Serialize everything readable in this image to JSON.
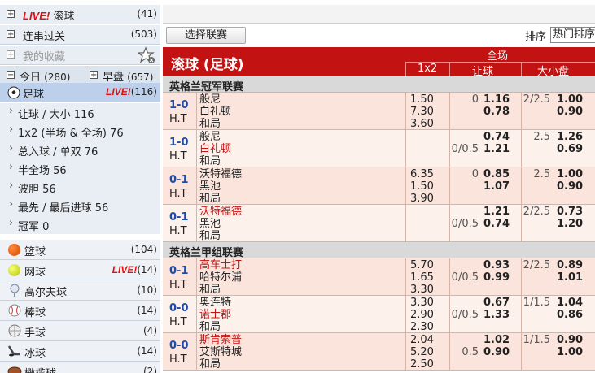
{
  "sidebar": {
    "live_badge": "LIVE!",
    "inplay": {
      "label": "滚球",
      "count": "(41)"
    },
    "parlay": {
      "label": "连串过关",
      "count": "(503)"
    },
    "favorites": {
      "label": "我的收藏"
    },
    "today": {
      "label": "今日",
      "count": "(280)"
    },
    "early": {
      "label": "早盘",
      "count": "(657)"
    },
    "football": {
      "label": "足球",
      "count": "(116)"
    },
    "bet_types": [
      {
        "label": "让球 / 大小  116"
      },
      {
        "label": "1x2 (半场 & 全场)  76"
      },
      {
        "label": "总入球 / 单双  76"
      },
      {
        "label": "半全场  56"
      },
      {
        "label": "波胆  56"
      },
      {
        "label": "最先 / 最后进球  56"
      },
      {
        "label": "冠军  0"
      }
    ],
    "sports": [
      {
        "label": "篮球",
        "count": "(104)",
        "live": ""
      },
      {
        "label": "网球",
        "count": "(14)",
        "live": "LIVE!"
      },
      {
        "label": "高尔夫球",
        "count": "(10)",
        "live": ""
      },
      {
        "label": "棒球",
        "count": "(14)",
        "live": ""
      },
      {
        "label": "手球",
        "count": "(4)",
        "live": ""
      },
      {
        "label": "冰球",
        "count": "(14)",
        "live": ""
      },
      {
        "label": "橄榄球",
        "count": "(2)",
        "live": ""
      }
    ]
  },
  "toolbar": {
    "select_league": "选择联赛",
    "sort_label": "排序",
    "sort_value": "热门排序"
  },
  "table": {
    "title": "滚球 (足球)",
    "full_time": "全场",
    "col_1x2": "1x2",
    "col_handicap": "让球",
    "col_ou": "大小盘",
    "colors": {
      "header": "#c21212",
      "row": "#fbe4dc",
      "row_alt": "#fdf1ec",
      "team_red": "#c21212"
    },
    "leagues": [
      {
        "name": "英格兰冠军联赛"
      },
      {
        "name": "英格兰甲组联赛"
      }
    ],
    "matches": [
      {
        "score": "1-0",
        "half": "H.T",
        "home": "般尼",
        "away": "白礼顿",
        "draw_label": "和局",
        "home_red": false,
        "away_red": false,
        "x12": [
          "1.50",
          "7.30",
          "3.60"
        ],
        "hdp_line": "0",
        "hdp_home": "1.16",
        "hdp_away": "0.78",
        "ou_line": "2/2.5",
        "ou_over": "1.00",
        "ou_under": "0.90"
      },
      {
        "score": "1-0",
        "half": "H.T",
        "home": "般尼",
        "away": "白礼顿",
        "draw_label": "和局",
        "home_red": false,
        "away_red": true,
        "x12": [
          "",
          "",
          ""
        ],
        "hdp_line": "0/0.5",
        "hdp_home": "0.74",
        "hdp_away": "1.21",
        "ou_line": "2.5",
        "ou_over": "1.26",
        "ou_under": "0.69"
      },
      {
        "score": "0-1",
        "half": "H.T",
        "home": "沃特福德",
        "away": "黑池",
        "draw_label": "和局",
        "home_red": false,
        "away_red": false,
        "x12": [
          "6.35",
          "1.50",
          "3.90"
        ],
        "hdp_line": "0",
        "hdp_home": "0.85",
        "hdp_away": "1.07",
        "ou_line": "2.5",
        "ou_over": "1.00",
        "ou_under": "0.90"
      },
      {
        "score": "0-1",
        "half": "H.T",
        "home": "沃特福德",
        "away": "黑池",
        "draw_label": "和局",
        "home_red": true,
        "away_red": false,
        "x12": [
          "",
          "",
          ""
        ],
        "hdp_line": "0/0.5",
        "hdp_home": "1.21",
        "hdp_away": "0.74",
        "ou_line": "2/2.5",
        "ou_over": "0.73",
        "ou_under": "1.20"
      },
      {
        "score": "0-1",
        "half": "H.T",
        "home": "高车士打",
        "away": "哈特尔浦",
        "draw_label": "和局",
        "home_red": true,
        "away_red": false,
        "x12": [
          "5.70",
          "1.65",
          "3.30"
        ],
        "hdp_line": "0/0.5",
        "hdp_home": "0.93",
        "hdp_away": "0.99",
        "ou_line": "2/2.5",
        "ou_over": "0.89",
        "ou_under": "1.01"
      },
      {
        "score": "0-0",
        "half": "H.T",
        "home": "奥连特",
        "away": "诺士郡",
        "draw_label": "和局",
        "home_red": false,
        "away_red": true,
        "x12": [
          "3.30",
          "2.90",
          "2.30"
        ],
        "hdp_line": "0/0.5",
        "hdp_home": "0.67",
        "hdp_away": "1.33",
        "ou_line": "1/1.5",
        "ou_over": "1.04",
        "ou_under": "0.86"
      },
      {
        "score": "0-0",
        "half": "H.T",
        "home": "斯肯索普",
        "away": "艾斯特城",
        "draw_label": "和局",
        "home_red": true,
        "away_red": false,
        "x12": [
          "2.04",
          "5.20",
          "2.50"
        ],
        "hdp_line": "0.5",
        "hdp_home": "1.02",
        "hdp_away": "0.90",
        "ou_line": "1/1.5",
        "ou_over": "0.90",
        "ou_under": "1.00"
      }
    ]
  }
}
